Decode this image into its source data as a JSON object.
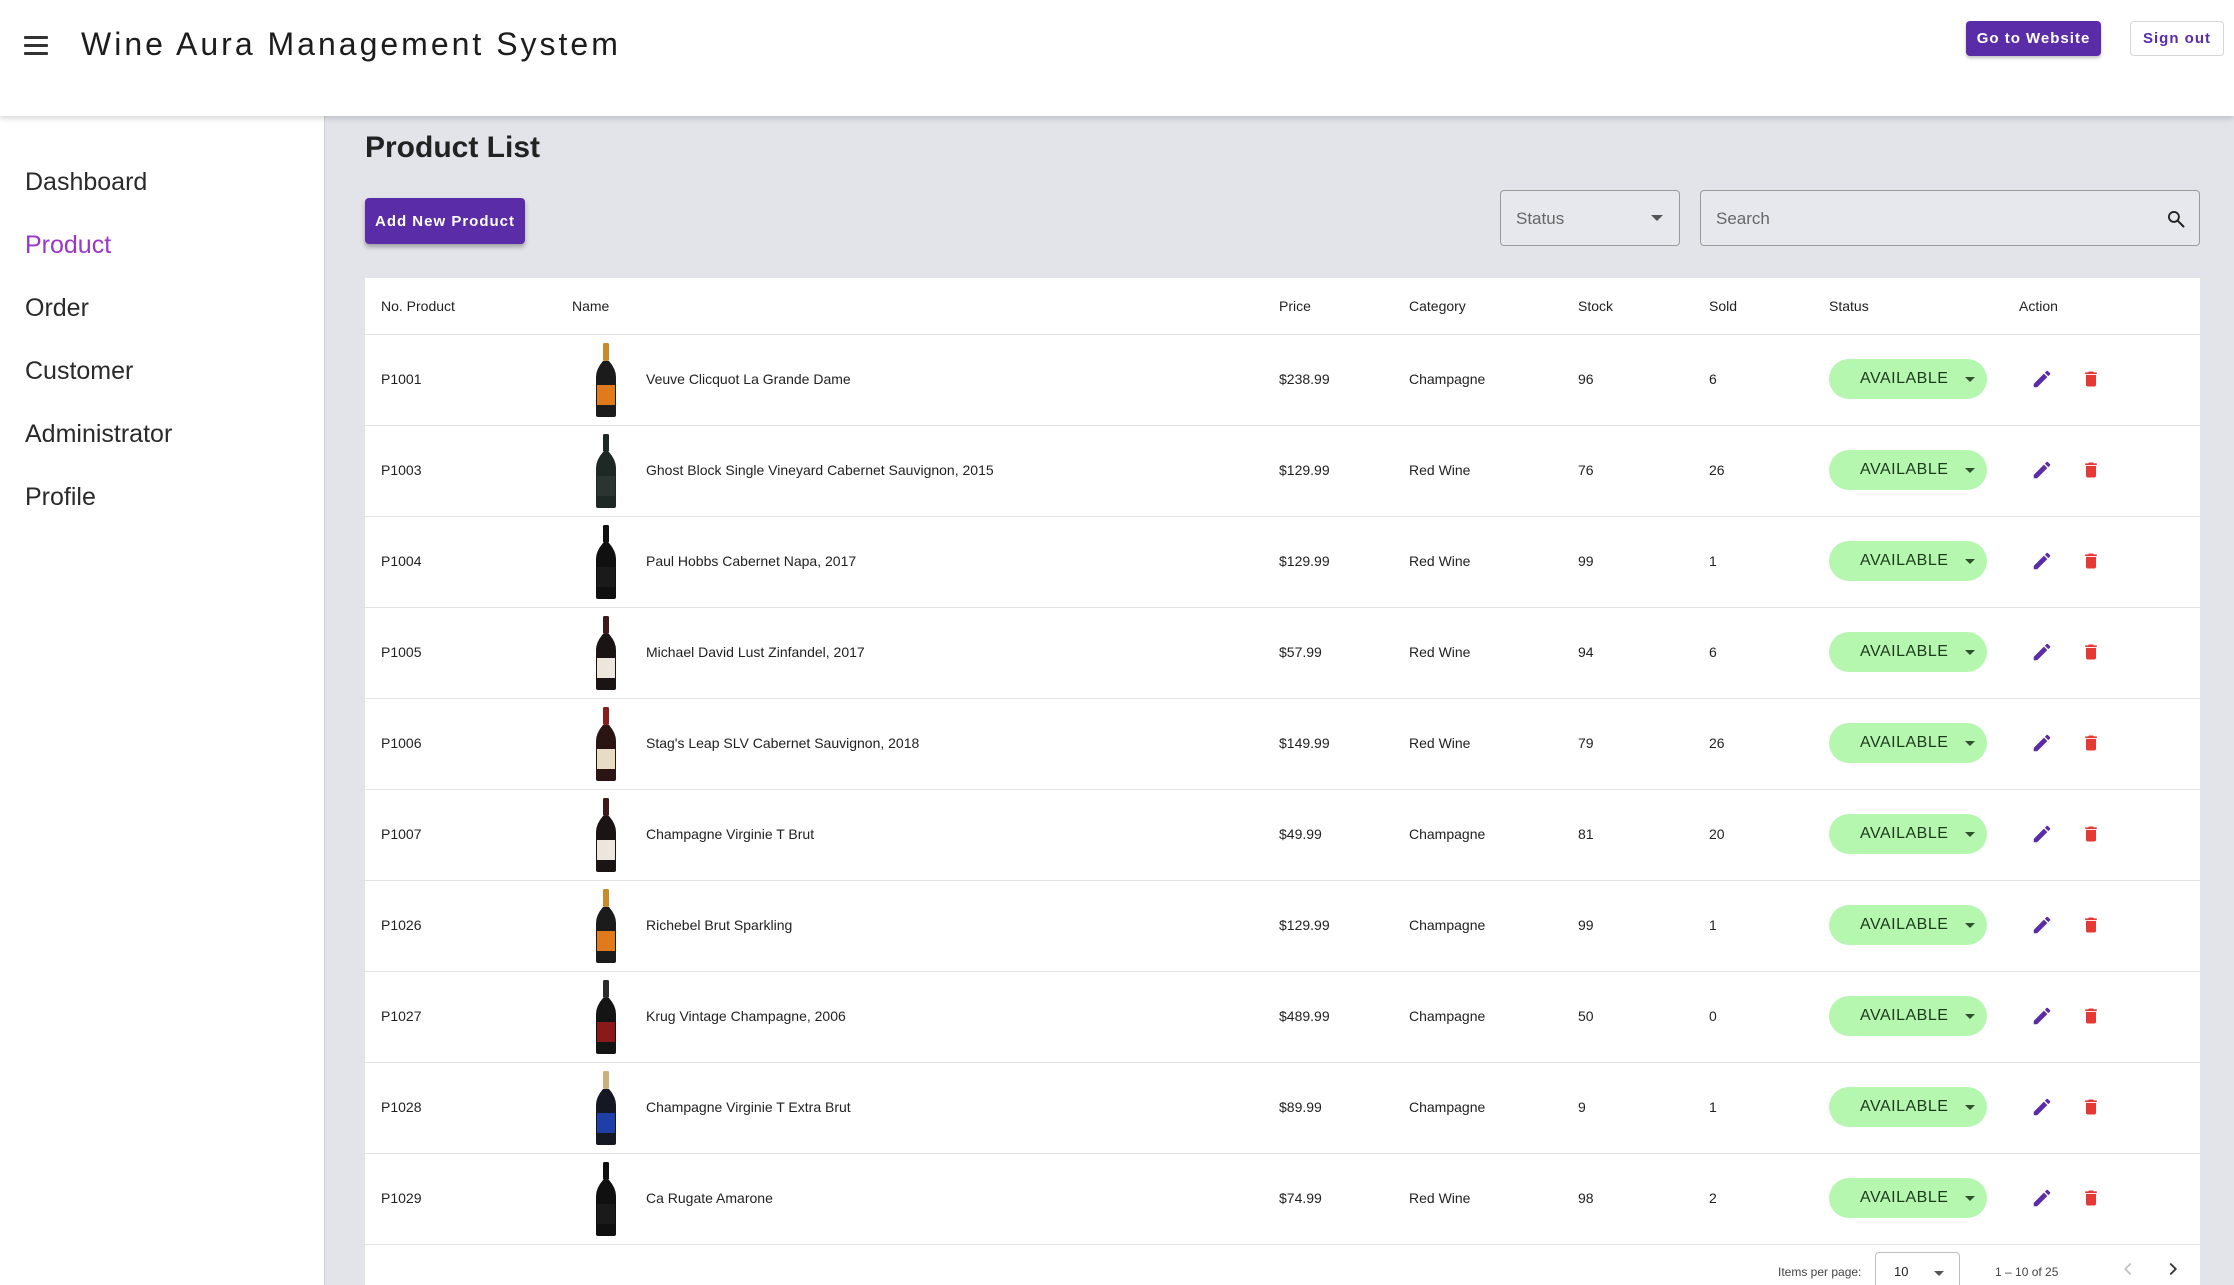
{
  "header": {
    "title": "Wine Aura Management System",
    "go_to_website": "Go to Website",
    "sign_out": "Sign out"
  },
  "sidebar": {
    "items": [
      {
        "label": "Dashboard",
        "active": false
      },
      {
        "label": "Product",
        "active": true
      },
      {
        "label": "Order",
        "active": false
      },
      {
        "label": "Customer",
        "active": false
      },
      {
        "label": "Administrator",
        "active": false
      },
      {
        "label": "Profile",
        "active": false
      }
    ]
  },
  "main": {
    "title": "Product List",
    "add_button": "Add New Product",
    "status_filter_label": "Status",
    "search_placeholder": "Search"
  },
  "table": {
    "columns": {
      "no": "No. Product",
      "name": "Name",
      "price": "Price",
      "category": "Category",
      "stock": "Stock",
      "sold": "Sold",
      "status": "Status",
      "action": "Action"
    },
    "rows": [
      {
        "id": "P1001",
        "name": "Veuve Clicquot La Grande Dame",
        "price": "$238.99",
        "category": "Champagne",
        "stock": "96",
        "sold": "6",
        "status": "AVAILABLE",
        "bottle": "champagne-gold"
      },
      {
        "id": "P1003",
        "name": "Ghost Block Single Vineyard Cabernet Sauvignon, 2015",
        "price": "$129.99",
        "category": "Red Wine",
        "stock": "76",
        "sold": "26",
        "status": "AVAILABLE",
        "bottle": "red-dark"
      },
      {
        "id": "P1004",
        "name": "Paul Hobbs Cabernet Napa, 2017",
        "price": "$129.99",
        "category": "Red Wine",
        "stock": "99",
        "sold": "1",
        "status": "AVAILABLE",
        "bottle": "red-black"
      },
      {
        "id": "P1005",
        "name": "Michael David Lust Zinfandel, 2017",
        "price": "$57.99",
        "category": "Red Wine",
        "stock": "94",
        "sold": "6",
        "status": "AVAILABLE",
        "bottle": "red-white-label"
      },
      {
        "id": "P1006",
        "name": "Stag's Leap SLV Cabernet Sauvignon, 2018",
        "price": "$149.99",
        "category": "Red Wine",
        "stock": "79",
        "sold": "26",
        "status": "AVAILABLE",
        "bottle": "red-cream-label"
      },
      {
        "id": "P1007",
        "name": "Champagne Virginie T Brut",
        "price": "$49.99",
        "category": "Champagne",
        "stock": "81",
        "sold": "20",
        "status": "AVAILABLE",
        "bottle": "red-white-label"
      },
      {
        "id": "P1026",
        "name": "Richebel Brut Sparkling",
        "price": "$129.99",
        "category": "Champagne",
        "stock": "99",
        "sold": "1",
        "status": "AVAILABLE",
        "bottle": "champagne-gold"
      },
      {
        "id": "P1027",
        "name": "Krug Vintage Champagne, 2006",
        "price": "$489.99",
        "category": "Champagne",
        "stock": "50",
        "sold": "0",
        "status": "AVAILABLE",
        "bottle": "champagne-black"
      },
      {
        "id": "P1028",
        "name": "Champagne Virginie T Extra Brut",
        "price": "$89.99",
        "category": "Champagne",
        "stock": "9",
        "sold": "1",
        "status": "AVAILABLE",
        "bottle": "champagne-blue"
      },
      {
        "id": "P1029",
        "name": "Ca Rugate Amarone",
        "price": "$74.99",
        "category": "Red Wine",
        "stock": "98",
        "sold": "2",
        "status": "AVAILABLE",
        "bottle": "red-black"
      }
    ]
  },
  "pagination": {
    "items_per_page_label": "Items per page:",
    "items_per_page": "10",
    "range": "1 – 10 of 25"
  },
  "colors": {
    "primary": "#5b2ca7",
    "active_nav": "#9a37c8",
    "status_bg": "#b6f7b0",
    "delete": "#e53935",
    "edit": "#5b2ca7"
  }
}
